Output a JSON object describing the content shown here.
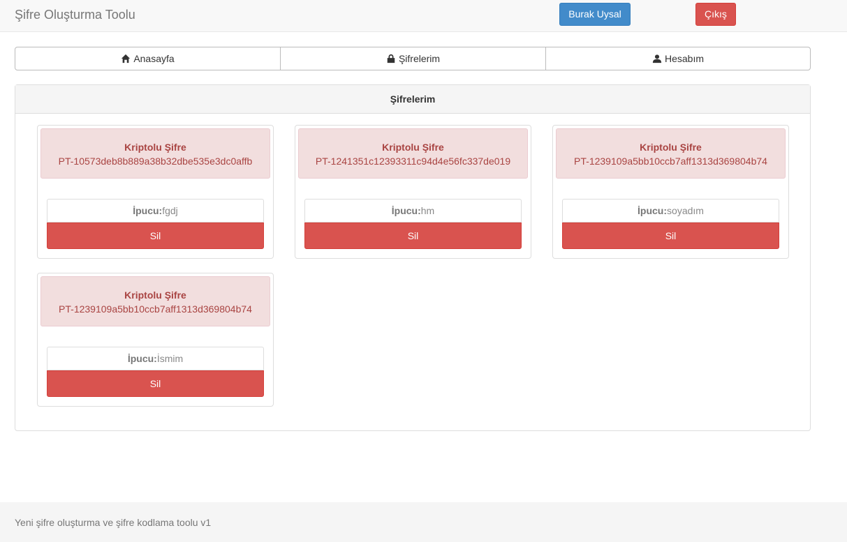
{
  "navbar": {
    "brand": "Şifre Oluşturma Toolu",
    "user_button": "Burak Uysal",
    "logout_button": "Çıkış",
    "user_button_color": "#428bca",
    "logout_button_color": "#d9534f"
  },
  "tabs": [
    {
      "label": "Anasayfa",
      "icon": "home-icon"
    },
    {
      "label": "Şifrelerim",
      "icon": "lock-icon"
    },
    {
      "label": "Hesabım",
      "icon": "user-icon"
    }
  ],
  "panel": {
    "title": "Şifrelerim",
    "cards": [
      {
        "title": "Kriptolu Şifre",
        "code": "PT-10573deb8b889a38b32dbe535e3dc0affb",
        "hint_label": "İpucu:",
        "hint_value": "fgdj",
        "delete_label": "Sil"
      },
      {
        "title": "Kriptolu Şifre",
        "code": "PT-1241351c12393311c94d4e56fc337de019",
        "hint_label": "İpucu:",
        "hint_value": "hm",
        "delete_label": "Sil"
      },
      {
        "title": "Kriptolu Şifre",
        "code": "PT-1239109a5bb10ccb7aff1313d369804b74",
        "hint_label": "İpucu:",
        "hint_value": "soyadım",
        "delete_label": "Sil"
      },
      {
        "title": "Kriptolu Şifre",
        "code": "PT-1239109a5bb10ccb7aff1313d369804b74",
        "hint_label": "İpucu:",
        "hint_value": "İsmim",
        "delete_label": "Sil"
      }
    ]
  },
  "footer": {
    "text": "Yeni şifre oluşturma ve şifre kodlama toolu v1"
  }
}
